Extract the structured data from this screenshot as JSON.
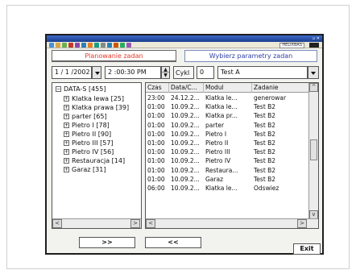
{
  "toolbar": {
    "right_label": "HELIXBAS",
    "icons": [
      "tb-a-icon",
      "tb-b-icon",
      "tb-c-icon",
      "tb-d-icon",
      "tb-e-icon",
      "tb-f-icon",
      "tb-g-icon",
      "tb-h-icon",
      "tb-i-icon",
      "tb-j-icon",
      "tb-k-icon",
      "tb-l-icon",
      "tb-m-icon"
    ]
  },
  "tabs": {
    "left": "Planowanie zadan",
    "right": "Wybierz parametry zadan"
  },
  "controls": {
    "date_value": "1 / 1 /2002",
    "time_value": "2 :00:30 PM",
    "spin_up": "▲",
    "spin_down": "▼",
    "cycle_label": "Cykl",
    "cycle_value": "0",
    "test_value": "Test A"
  },
  "tree": {
    "root": "DATA-S [455]",
    "expand_symbol": "+",
    "collapse_symbol": "−",
    "nodes": [
      "Klatka lewa [25]",
      "Klatka prawa [39]",
      "parter [65]",
      "Pietro I [78]",
      "Pietro II [90]",
      "Pietro III [57]",
      "Pietro IV [56]",
      "Restauracja [14]",
      "Garaz [31]"
    ]
  },
  "table": {
    "headers": [
      "Czas",
      "Data/C...",
      "Modul",
      "Zadanie"
    ],
    "rows": [
      [
        "23:00",
        "24.12.2...",
        "Klatka le...",
        "generowar"
      ],
      [
        "01:00",
        "10.09.2...",
        "Klatka le...",
        "Test B2"
      ],
      [
        "01:00",
        "10.09.2...",
        "Klatka pr...",
        "Test B2"
      ],
      [
        "01:00",
        "10.09.2...",
        "parter",
        "Test B2"
      ],
      [
        "01:00",
        "10.09.2...",
        "Pietro I",
        "Test B2"
      ],
      [
        "01:00",
        "10.09.2...",
        "Pietro II",
        "Test B2"
      ],
      [
        "01:00",
        "10.09.2...",
        "Pietro III",
        "Test B2"
      ],
      [
        "01:00",
        "10.09.2...",
        "Pietro IV",
        "Test B2"
      ],
      [
        "01:00",
        "10.09.2...",
        "Restaura...",
        "Test B2"
      ],
      [
        "01:00",
        "10.09.2...",
        "Garaz",
        "Test B2"
      ],
      [
        "06:00",
        "10.09.2...",
        "Klatka le...",
        "Odswiez"
      ]
    ]
  },
  "scroll": {
    "left_arrow": "<",
    "right_arrow": ">",
    "up_arrow": "^",
    "down_arrow": "v"
  },
  "buttons": {
    "forward": ">>",
    "back": "<<",
    "exit": "Exit"
  }
}
